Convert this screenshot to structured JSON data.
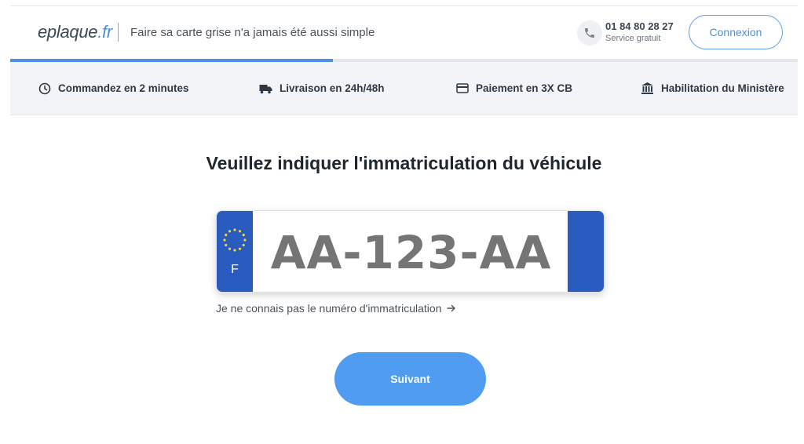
{
  "header": {
    "logo_main": "eplaque",
    "logo_suffix": ".fr",
    "tagline": "Faire sa carte grise n'a jamais été aussi simple",
    "phone_icon": "phone-icon",
    "phone_number": "01 84 80 28 27",
    "phone_note": "Service gratuit",
    "login_label": "Connexion"
  },
  "progress": {
    "fraction": 0.41
  },
  "features": [
    {
      "icon": "clock-icon",
      "label": "Commandez en 2 minutes"
    },
    {
      "icon": "truck-icon",
      "label": "Livraison en 24h/48h"
    },
    {
      "icon": "credit-card-icon",
      "label": "Paiement en 3X CB"
    },
    {
      "icon": "bank-icon",
      "label": "Habilitation du Ministère"
    }
  ],
  "main": {
    "title": "Veuillez indiquer l'immatriculation du véhicule",
    "plate": {
      "country_code": "F",
      "placeholder": "AA-123-AA",
      "value": ""
    },
    "unknown_link": "Je ne connais pas le numéro d'immatriculation",
    "next_label": "Suivant"
  },
  "colors": {
    "accent": "#4a90e8",
    "plate_blue": "#2a5bbf",
    "button": "#4f9cf0"
  }
}
